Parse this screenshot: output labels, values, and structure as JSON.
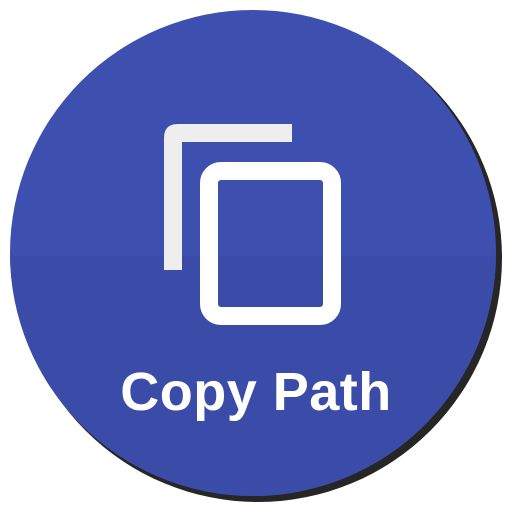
{
  "app_icon": {
    "label": "Copy Path",
    "glyph": "copy-icon",
    "colors": {
      "background": "#3D50B0",
      "background_shade": "#3A4CA8",
      "foreground": "#FFFFFF",
      "back_sheet": "#EEEEEE",
      "shadow": "#000000"
    }
  }
}
